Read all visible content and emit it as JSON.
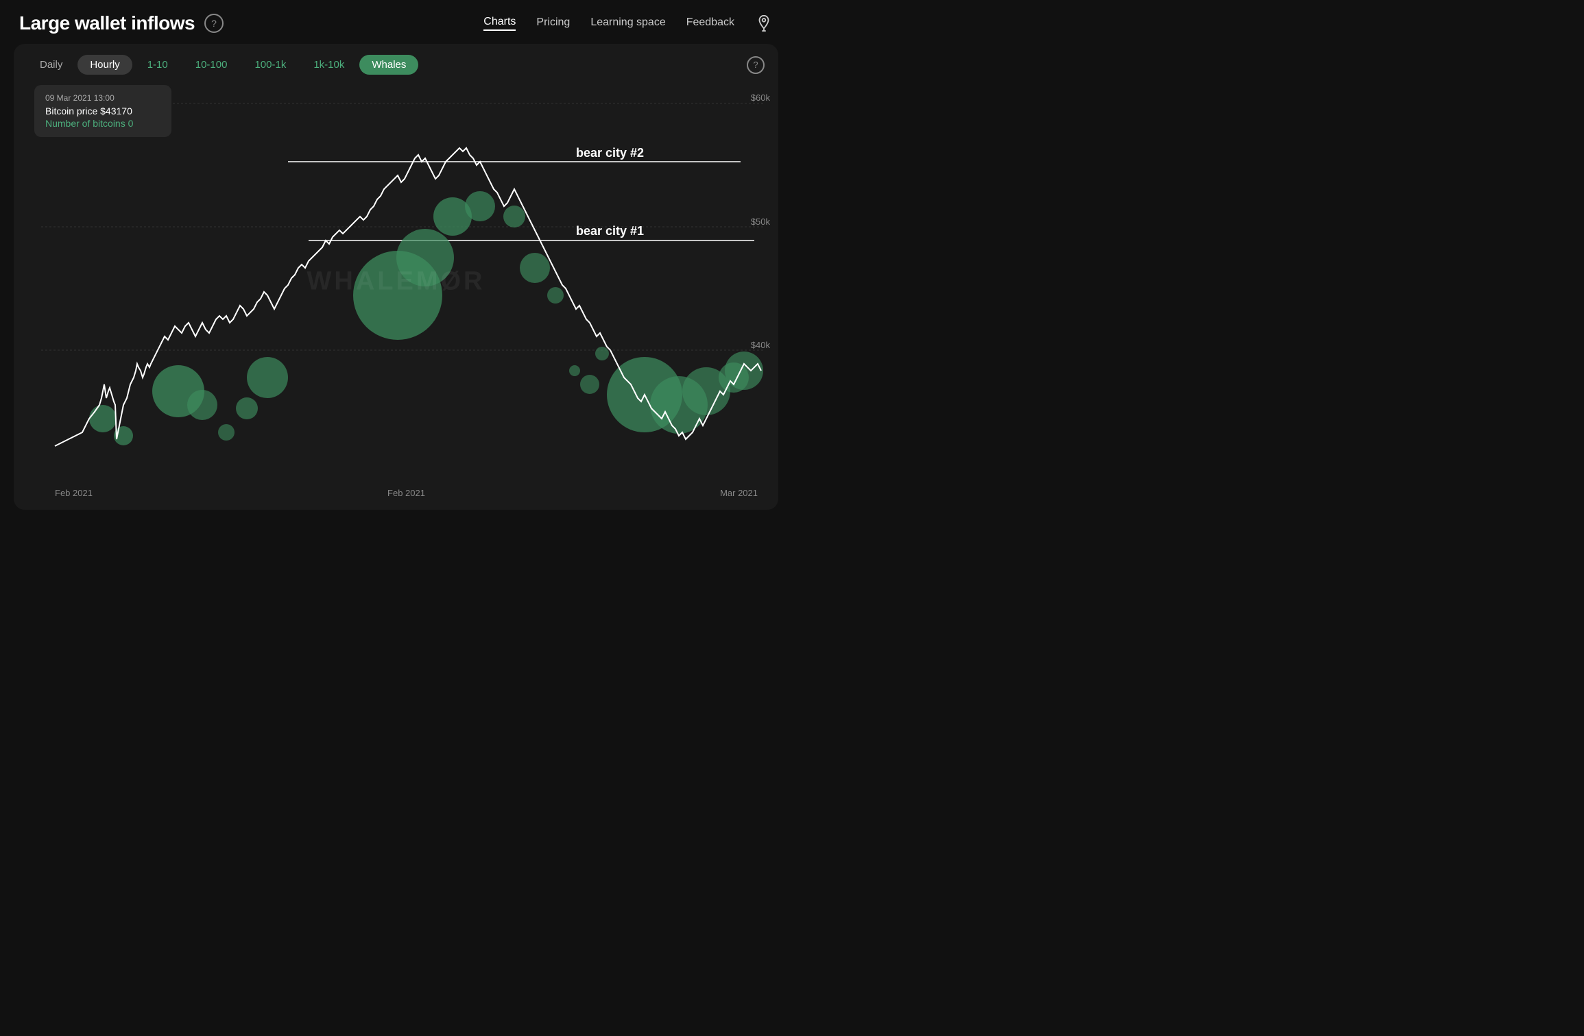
{
  "header": {
    "title": "Large wallet inflows",
    "help_label": "?",
    "nav": [
      {
        "label": "Charts",
        "active": true
      },
      {
        "label": "Pricing",
        "active": false
      },
      {
        "label": "Learning space",
        "active": false
      },
      {
        "label": "Feedback",
        "active": false
      }
    ]
  },
  "filters": {
    "time": [
      {
        "label": "Daily",
        "active": false
      },
      {
        "label": "Hourly",
        "active": true
      }
    ],
    "range": [
      {
        "label": "1-10",
        "active": false
      },
      {
        "label": "10-100",
        "active": false
      },
      {
        "label": "100-1k",
        "active": false
      },
      {
        "label": "1k-10k",
        "active": false
      },
      {
        "label": "Whales",
        "active": true
      }
    ]
  },
  "tooltip": {
    "date": "09 Mar 2021 13:00",
    "price_label": "Bitcoin price $43170",
    "btc_label": "Number of bitcoins 0"
  },
  "chart": {
    "y_labels": [
      {
        "value": "$60k",
        "pct": 5
      },
      {
        "value": "$50k",
        "pct": 38
      },
      {
        "value": "$40k",
        "pct": 71
      }
    ],
    "x_labels": [
      "Feb 2021",
      "Feb 2021",
      "Mar 2021"
    ],
    "watermark": "WHALEMØR",
    "annotations": [
      {
        "label": "bear city #2",
        "y_pct": 22
      },
      {
        "label": "bear city #1",
        "y_pct": 42
      }
    ]
  }
}
